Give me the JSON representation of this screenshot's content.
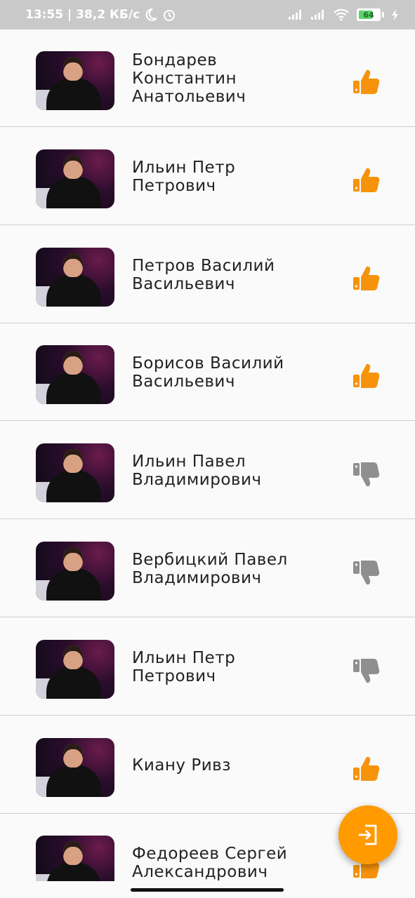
{
  "status_bar": {
    "time_speed": "13:55 | 38,2 КБ/с",
    "battery": "64",
    "battery_level": 0.64
  },
  "colors": {
    "like": "#f7930a",
    "dislike": "#8f8f8f",
    "fab": "#ff9a00"
  },
  "people": [
    {
      "name": "Бондарев Константин Анатольевич",
      "vote": "like"
    },
    {
      "name": "Ильин Петр Петрович",
      "vote": "like"
    },
    {
      "name": "Петров Василий Васильевич",
      "vote": "like"
    },
    {
      "name": "Борисов Василий Васильевич",
      "vote": "like"
    },
    {
      "name": "Ильин Павел Владимирович",
      "vote": "dislike"
    },
    {
      "name": "Вербицкий Павел Владимирович",
      "vote": "dislike"
    },
    {
      "name": "Ильин Петр Петрович",
      "vote": "dislike"
    },
    {
      "name": "Киану Ривз",
      "vote": "like"
    },
    {
      "name": "Федореев Сергей Александрович",
      "vote": "like"
    }
  ],
  "fab": {
    "icon": "exit-icon"
  }
}
